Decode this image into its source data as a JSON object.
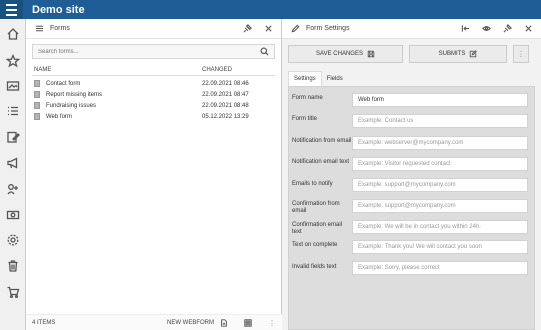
{
  "site": {
    "title": "Demo site"
  },
  "rail": {
    "icons": [
      "home-icon",
      "star-icon",
      "image-icon",
      "list-icon",
      "edit-icon",
      "megaphone-icon",
      "share-icon",
      "money-icon",
      "gear-icon",
      "trash-icon",
      "cart-icon"
    ]
  },
  "forms_panel": {
    "title": "Forms",
    "search_placeholder": "Search forms...",
    "columns": {
      "name": "NAME",
      "changed": "CHANGED"
    },
    "rows": [
      {
        "name": "Contact form",
        "changed": "22.09.2021 08:46"
      },
      {
        "name": "Report missing items",
        "changed": "22.09.2021 08:47"
      },
      {
        "name": "Fundraising issues",
        "changed": "22.09.2021 08:48"
      },
      {
        "name": "Web form",
        "changed": "05.12.2022 13:29"
      }
    ],
    "footer": {
      "count": "4 ITEMS",
      "new_webform": "NEW WEBFORM"
    }
  },
  "settings_panel": {
    "title": "Form Settings",
    "save_label": "SAVE CHANGES",
    "submits_label": "SUBMITS",
    "tabs": [
      {
        "label": "Settings"
      },
      {
        "label": "Fields"
      }
    ],
    "fields": [
      {
        "label": "Form name",
        "value": "Web form",
        "placeholder": ""
      },
      {
        "label": "Form title",
        "value": "",
        "placeholder": "Example: Contact us"
      },
      {
        "label": "Notification from email",
        "value": "",
        "placeholder": "Example: webserver@mycompany.com"
      },
      {
        "label": "Notification email text",
        "value": "",
        "placeholder": "Example: Visitor requested contact"
      },
      {
        "label": "Emails to notify",
        "value": "",
        "placeholder": "Example: support@mycompany.com"
      },
      {
        "label": "Confirmation from email",
        "value": "",
        "placeholder": "Example: support@mycompany.com"
      },
      {
        "label": "Confirmation email text",
        "value": "",
        "placeholder": "Example: We will be in contact you within 24h."
      },
      {
        "label": "Text on complete",
        "value": "",
        "placeholder": "Example: Thank you! We will contact you soon"
      },
      {
        "label": "Invalid fields text",
        "value": "",
        "placeholder": "Example: Sorry, please correct"
      }
    ]
  },
  "colors": {
    "topbar": "#1e5d95",
    "rail": "#f0f0f0"
  }
}
